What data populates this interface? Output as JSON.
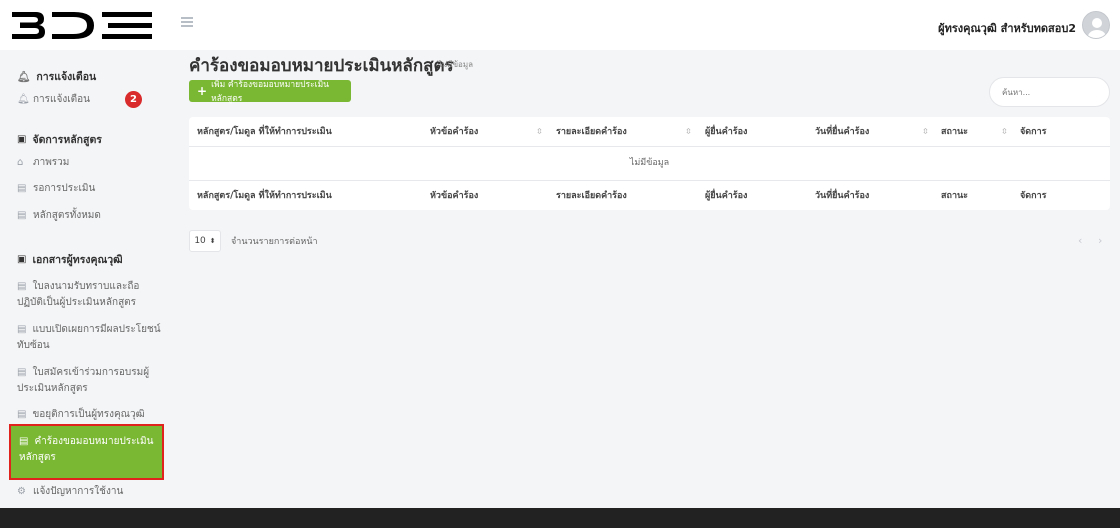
{
  "header": {
    "logo_text": "BDE",
    "user_name": "ผู้ทรงคุณวุฒิ สำหรับทดสอบ2"
  },
  "sidebar": {
    "notify_section": {
      "title": "การแจ้งเตือน",
      "icon": "bell-icon"
    },
    "notify_item": {
      "label": "การแจ้งเตือน",
      "icon": "bell-icon",
      "badge": "2"
    },
    "course_section": {
      "title": "จัดการหลักสูตร",
      "icon": "panel-icon"
    },
    "course_items": [
      {
        "label": "ภาพรวม",
        "icon": "home-icon"
      },
      {
        "label": "รอการประเมิน",
        "icon": "document-icon"
      },
      {
        "label": "หลักสูตรทั้งหมด",
        "icon": "document-icon"
      }
    ],
    "doc_section": {
      "title": "เอกสารผู้ทรงคุณวุฒิ",
      "icon": "panel-icon"
    },
    "doc_items": [
      {
        "label": "ใบลงนามรับทราบและถือปฏิบัติเป็นผู้ประเมินหลักสูตร",
        "icon": "document-icon"
      },
      {
        "label": "แบบเปิดเผยการมีผลประโยชน์ทับซ้อน",
        "icon": "document-icon"
      },
      {
        "label": "ใบสมัครเข้าร่วมการอบรมผู้ประเมินหลักสูตร",
        "icon": "document-icon"
      },
      {
        "label": "ขอยุติการเป็นผู้ทรงคุณวุฒิ",
        "icon": "document-icon"
      }
    ],
    "active_item": {
      "label": "คำร้องขอมอบหมายประเมินหลักสูตร",
      "icon": "document-icon"
    },
    "report_item": {
      "label": "แจ้งปัญหาการใช้งาน",
      "icon": "gear-icon"
    }
  },
  "main": {
    "title": "คำร้องขอมอบหมายประเมินหลักสูตร",
    "subtitle": "ไม่มีข้อมูล",
    "add_button": "เพิ่ม คำร้องขอมอบหมายประเมินหลักสูตร",
    "search_placeholder": "ค้นหา...",
    "columns": [
      "หลักสูตร/โมดูล ที่ให้ทำการประเมิน",
      "หัวข้อคำร้อง",
      "รายละเอียดคำร้อง",
      "ผู้ยื่นคำร้อง",
      "วันที่ยื่นคำร้อง",
      "สถานะ",
      "จัดการ"
    ],
    "empty_text": "ไม่มีข้อมูล",
    "page_size": "10",
    "page_size_label": "จำนวนรายการต่อหน้า",
    "prev": "‹",
    "next": "›"
  },
  "colors": {
    "accent_green": "#7ab733",
    "badge_red": "#d92b2b",
    "highlight_border": "#e0231c",
    "footer": "#222222"
  }
}
